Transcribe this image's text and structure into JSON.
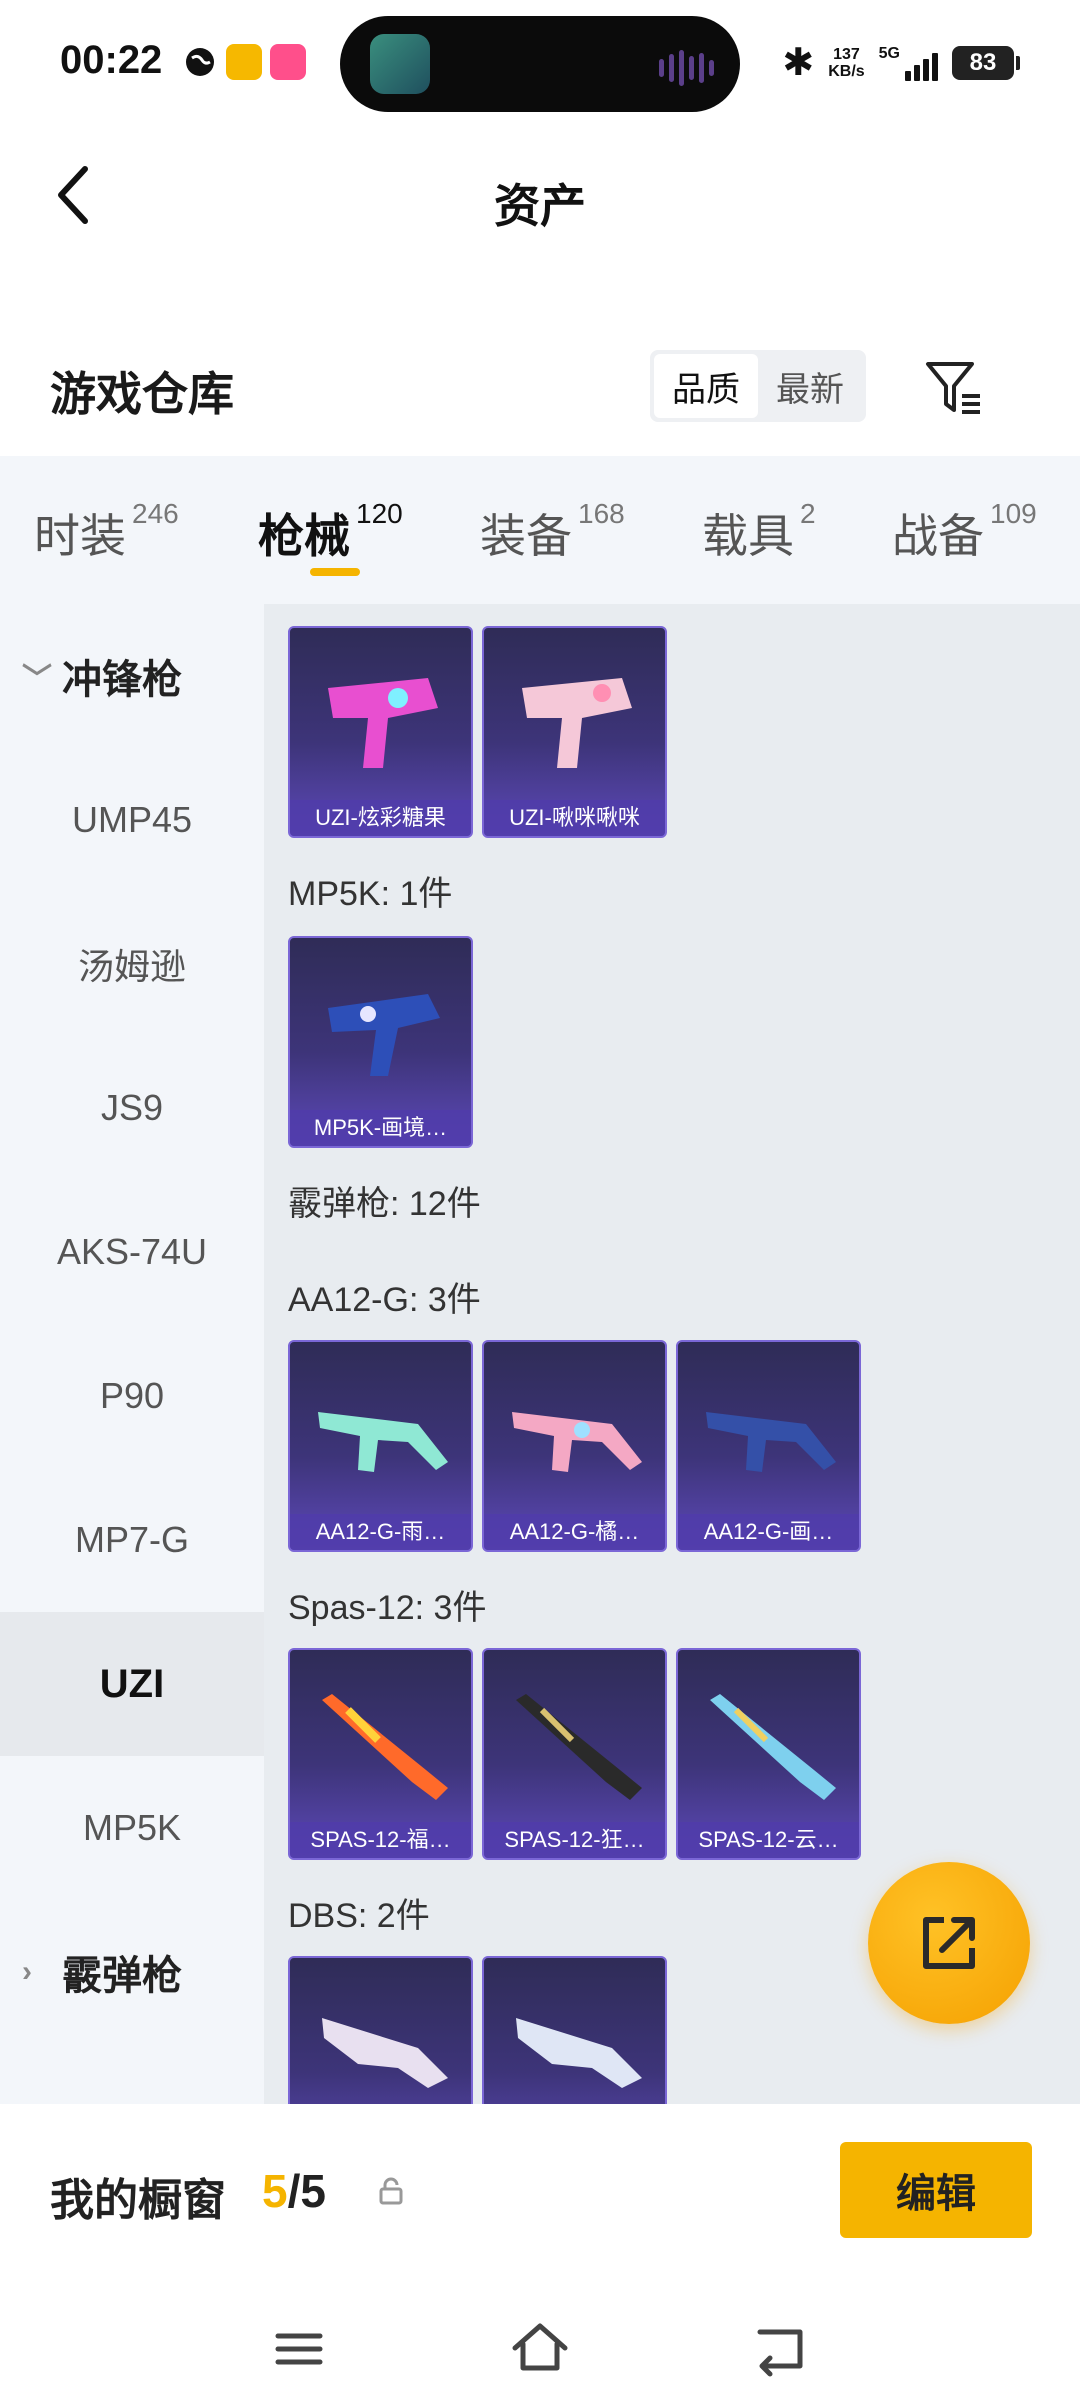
{
  "status_bar": {
    "time": "00:22",
    "net_speed_value": "137",
    "net_speed_unit": "KB/s",
    "network": "5G",
    "battery": "83"
  },
  "header": {
    "title": "资产"
  },
  "section": {
    "title": "游戏仓库",
    "sort_options": [
      "品质",
      "最新"
    ],
    "active_sort": "品质"
  },
  "tabs": [
    {
      "label": "时装",
      "count": "246"
    },
    {
      "label": "枪械",
      "count": "120",
      "active": true
    },
    {
      "label": "装备",
      "count": "168"
    },
    {
      "label": "载具",
      "count": "2"
    },
    {
      "label": "战备",
      "count": "109"
    }
  ],
  "sidebar": {
    "group_1": "冲锋枪",
    "items": [
      "UMP45",
      "汤姆逊",
      "JS9",
      "AKS-74U",
      "P90",
      "MP7-G",
      "UZI",
      "MP5K"
    ],
    "selected": "UZI",
    "group_2": "霰弹枪"
  },
  "content": {
    "uzi_cards": [
      "UZI-炫彩糖果",
      "UZI-啾咪啾咪"
    ],
    "mp5k_label": "MP5K: 1件",
    "mp5k_cards": [
      "MP5K-画境…"
    ],
    "shotgun_label": "霰弹枪: 12件",
    "aa12_label": "AA12-G: 3件",
    "aa12_cards": [
      "AA12-G-雨…",
      "AA12-G-橘…",
      "AA12-G-画…"
    ],
    "spas_label": "Spas-12: 3件",
    "spas_cards": [
      "SPAS-12-福…",
      "SPAS-12-狂…",
      "SPAS-12-云…"
    ],
    "dbs_label": "DBS: 2件"
  },
  "bottom": {
    "showcase_label": "我的橱窗",
    "showcase_current": "5",
    "showcase_total": "/5",
    "edit_label": "编辑"
  },
  "colors": {
    "accent": "#f5b400",
    "card_bg": "#3d3479",
    "sidebar_bg": "#f3f6fa",
    "content_bg": "#e8ecf0"
  }
}
